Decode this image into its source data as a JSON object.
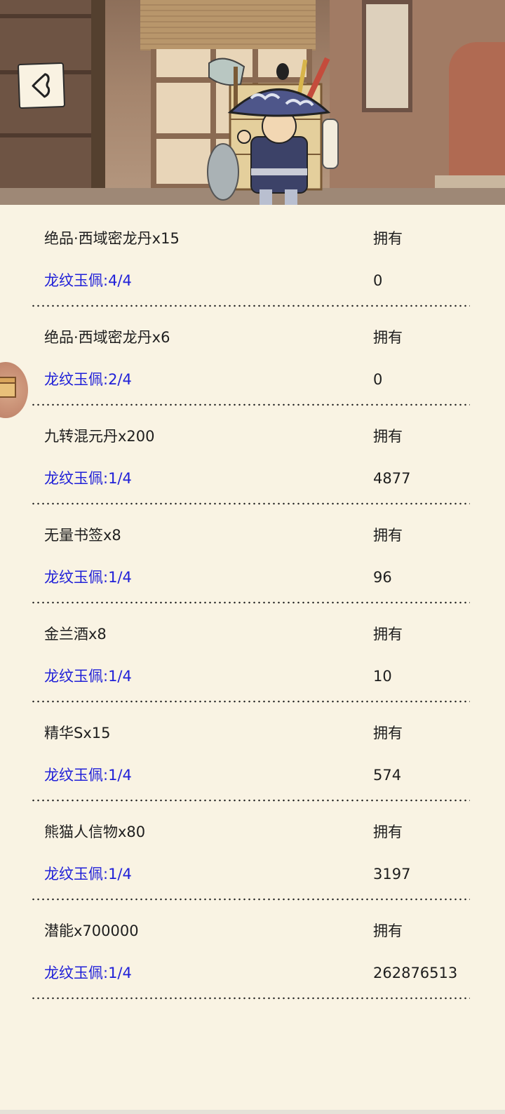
{
  "header": {
    "back_icon": "chevron-left-icon",
    "merchant_icon": "traveling-merchant-illustration"
  },
  "list": {
    "items": [
      {
        "name": "绝品·西域密龙丹x15",
        "requirement": "龙纹玉佩:4/4",
        "own_label": "拥有",
        "owned": "0"
      },
      {
        "name": "绝品·西域密龙丹x6",
        "requirement": "龙纹玉佩:2/4",
        "own_label": "拥有",
        "owned": "0"
      },
      {
        "name": "九转混元丹x200",
        "requirement": "龙纹玉佩:1/4",
        "own_label": "拥有",
        "owned": "4877"
      },
      {
        "name": "无量书签x8",
        "requirement": "龙纹玉佩:1/4",
        "own_label": "拥有",
        "owned": "96"
      },
      {
        "name": "金兰酒x8",
        "requirement": "龙纹玉佩:1/4",
        "own_label": "拥有",
        "owned": "10"
      },
      {
        "name": "精华Sx15",
        "requirement": "龙纹玉佩:1/4",
        "own_label": "拥有",
        "owned": "574"
      },
      {
        "name": "熊猫人信物x80",
        "requirement": "龙纹玉佩:1/4",
        "own_label": "拥有",
        "owned": "3197"
      },
      {
        "name": "潜能x700000",
        "requirement": "龙纹玉佩:1/4",
        "own_label": "拥有",
        "owned": "262876513"
      }
    ]
  },
  "side_float": {
    "icon": "treasure-chest-icon"
  },
  "colors": {
    "background": "#f9f3e3",
    "requirement_text": "#2020d8",
    "body_text": "#1e1e1e"
  }
}
